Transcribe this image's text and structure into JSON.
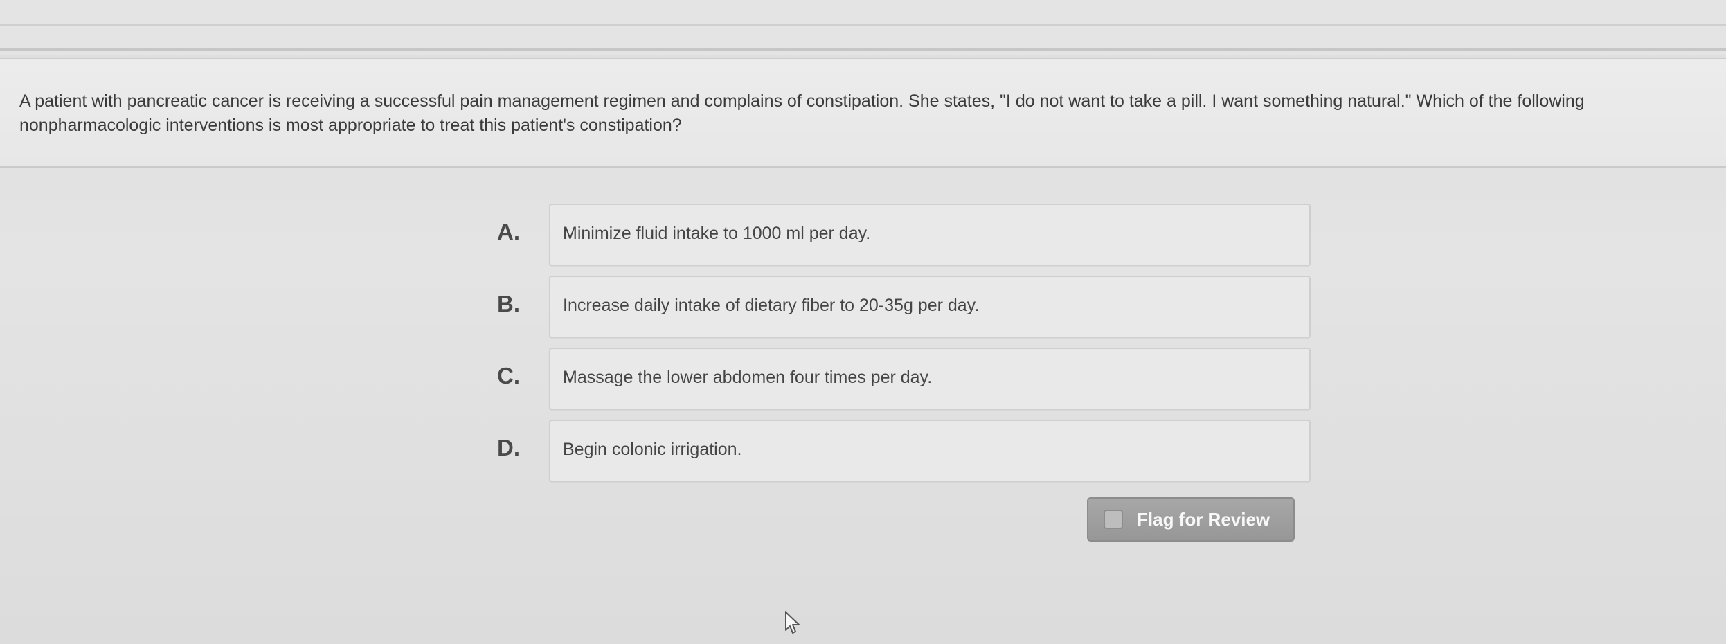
{
  "question": {
    "text": "A patient with pancreatic cancer is receiving a successful pain management regimen and complains of constipation. She states, \"I do not want to take a pill. I want something natural.\" Which of the following nonpharmacologic interventions is most appropriate to treat this patient's constipation?"
  },
  "options": [
    {
      "letter": "A.",
      "text": "Minimize fluid intake to 1000 ml per day."
    },
    {
      "letter": "B.",
      "text": "Increase daily intake of dietary fiber to 20-35g per day."
    },
    {
      "letter": "C.",
      "text": "Massage the lower abdomen four times per day."
    },
    {
      "letter": "D.",
      "text": "Begin colonic irrigation."
    }
  ],
  "flag": {
    "label": "Flag for Review",
    "checked": false,
    "icon": "checkbox-icon"
  },
  "cursor": {
    "icon": "mouse-pointer-icon"
  },
  "colors": {
    "background": "#e1e1e1",
    "question_panel": "#ececec",
    "option_box": "#e9e9e9",
    "flag_button": "#9f9f9f",
    "text": "#3b3b3b"
  }
}
